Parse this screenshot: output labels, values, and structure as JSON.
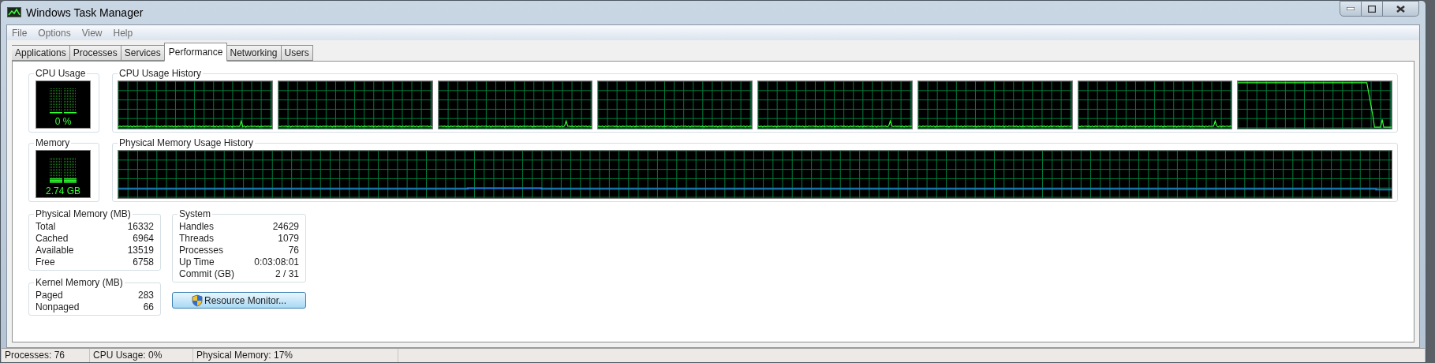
{
  "window": {
    "title": "Windows Task Manager"
  },
  "menu": [
    "File",
    "Options",
    "View",
    "Help"
  ],
  "tabs": [
    {
      "label": "Applications",
      "selected": false
    },
    {
      "label": "Processes",
      "selected": false
    },
    {
      "label": "Services",
      "selected": false
    },
    {
      "label": "Performance",
      "selected": true
    },
    {
      "label": "Networking",
      "selected": false
    },
    {
      "label": "Users",
      "selected": false
    }
  ],
  "cpu_usage": {
    "title": "CPU Usage",
    "reading": "0 %"
  },
  "cpu_history": {
    "title": "CPU Usage History"
  },
  "memory": {
    "title": "Memory",
    "reading": "2.74 GB"
  },
  "memory_history": {
    "title": "Physical Memory Usage History"
  },
  "physical_memory": {
    "title": "Physical Memory (MB)",
    "rows": [
      {
        "label": "Total",
        "value": "16332"
      },
      {
        "label": "Cached",
        "value": "6964"
      },
      {
        "label": "Available",
        "value": "13519"
      },
      {
        "label": "Free",
        "value": "6758"
      }
    ]
  },
  "kernel_memory": {
    "title": "Kernel Memory (MB)",
    "rows": [
      {
        "label": "Paged",
        "value": "283"
      },
      {
        "label": "Nonpaged",
        "value": "66"
      }
    ]
  },
  "system": {
    "title": "System",
    "rows": [
      {
        "label": "Handles",
        "value": "24629"
      },
      {
        "label": "Threads",
        "value": "1079"
      },
      {
        "label": "Processes",
        "value": "76"
      },
      {
        "label": "Up Time",
        "value": "0:03:08:01"
      },
      {
        "label": "Commit (GB)",
        "value": "2 / 31"
      }
    ]
  },
  "resource_monitor_button": "Resource Monitor...",
  "status_bar": [
    "Processes: 76",
    "CPU Usage: 0%",
    "Physical Memory: 17%"
  ]
}
